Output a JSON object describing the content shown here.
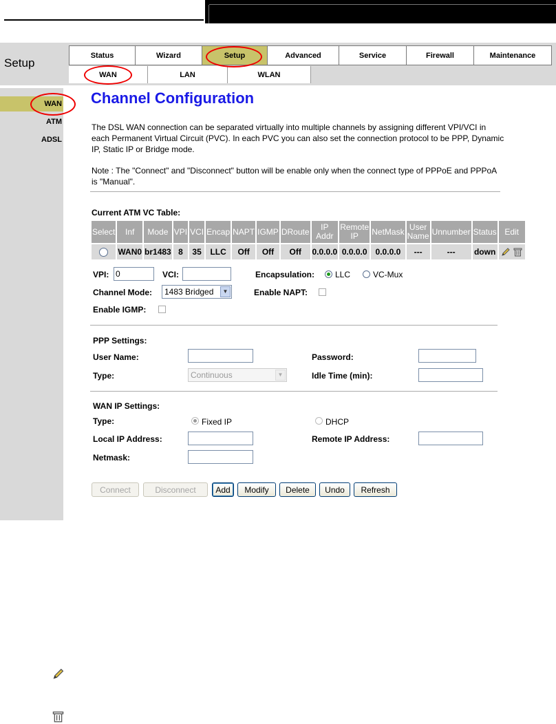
{
  "header": {
    "section_title": "Setup",
    "main_tabs": [
      "Status",
      "Wizard",
      "Setup",
      "Advanced",
      "Service",
      "Firewall",
      "Maintenance"
    ],
    "sub_tabs": [
      "WAN",
      "LAN",
      "WLAN"
    ]
  },
  "sidebar": {
    "items": [
      "WAN",
      "ATM",
      "ADSL"
    ]
  },
  "page": {
    "title": "Channel Configuration",
    "description": "The DSL WAN connection can be separated virtually into multiple channels by assigning different VPI/VCI in each Permanent Virtual Circuit (PVC). In each PVC you can also set the connection protocol to be PPP, Dynamic IP, Static IP or Bridge mode.",
    "note": "Note : The \"Connect\" and \"Disconnect\" button will be enable only when the connect type of PPPoE and PPPoA is \"Manual\"."
  },
  "vc_table": {
    "title": "Current ATM VC Table:",
    "headers": [
      "Select",
      "Inf",
      "Mode",
      "VPI",
      "VCI",
      "Encap",
      "NAPT",
      "IGMP",
      "DRoute",
      "IP Addr",
      "Remote IP",
      "NetMask",
      "User Name",
      "Unnumber",
      "Status",
      "Edit"
    ],
    "row": [
      "WAN0",
      "br1483",
      "8",
      "35",
      "LLC",
      "Off",
      "Off",
      "Off",
      "0.0.0.0",
      "0.0.0.0",
      "0.0.0.0",
      "---",
      "---",
      "down"
    ]
  },
  "form": {
    "vpi_label": "VPI:",
    "vpi_value": "0",
    "vci_label": "VCI:",
    "vci_value": "",
    "encap_label": "Encapsulation:",
    "encap_llc": "LLC",
    "encap_vcmux": "VC-Mux",
    "channel_mode_label": "Channel Mode:",
    "channel_mode_value": "1483 Bridged",
    "napt_label": "Enable NAPT:",
    "igmp_label": "Enable IGMP:"
  },
  "ppp": {
    "title": "PPP Settings:",
    "user_label": "User Name:",
    "password_label": "Password:",
    "type_label": "Type:",
    "type_value": "Continuous",
    "idle_label": "Idle Time (min):"
  },
  "wanip": {
    "title": "WAN IP Settings:",
    "type_label": "Type:",
    "fixed": "Fixed IP",
    "dhcp": "DHCP",
    "local_label": "Local IP Address:",
    "remote_label": "Remote IP Address:",
    "netmask_label": "Netmask:"
  },
  "buttons": [
    "Connect",
    "Disconnect",
    "Add",
    "Modify",
    "Delete",
    "Undo",
    "Refresh"
  ],
  "icons": {
    "edit": "pencil-icon",
    "delete": "trash-icon"
  },
  "colors": {
    "active_tab": "#c8c36a",
    "header_bg": "#d9d9d9",
    "title": "#1a1ae6",
    "annotation": "#e00000"
  }
}
